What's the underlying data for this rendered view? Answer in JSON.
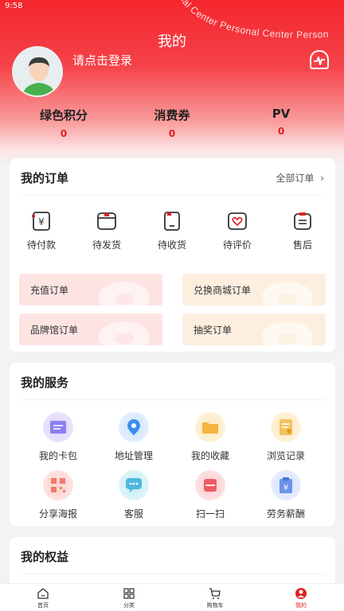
{
  "status_bar": {
    "time": "9:58"
  },
  "header": {
    "title": "我的",
    "login_prompt": "请点击登录",
    "arc_text": "onal Center Personal Center Person"
  },
  "stats": [
    {
      "label": "绿色积分",
      "value": "0"
    },
    {
      "label": "消费券",
      "value": "0"
    },
    {
      "label": "PV",
      "value": "0"
    }
  ],
  "orders": {
    "title": "我的订单",
    "all_link": "全部订单",
    "statuses": [
      {
        "label": "待付款",
        "icon": "pending-payment-icon"
      },
      {
        "label": "待发货",
        "icon": "pending-shipment-icon"
      },
      {
        "label": "待收货",
        "icon": "pending-receipt-icon"
      },
      {
        "label": "待评价",
        "icon": "pending-review-icon"
      },
      {
        "label": "售后",
        "icon": "after-sales-icon"
      }
    ],
    "entries": [
      {
        "label": "充值订单"
      },
      {
        "label": "兑换商城订单"
      },
      {
        "label": "品牌馆订单"
      },
      {
        "label": "抽奖订单"
      }
    ]
  },
  "services": {
    "title": "我的服务",
    "items": [
      {
        "label": "我的卡包",
        "icon": "card-wallet-icon"
      },
      {
        "label": "地址管理",
        "icon": "location-pin-icon"
      },
      {
        "label": "我的收藏",
        "icon": "folder-icon"
      },
      {
        "label": "浏览记录",
        "icon": "document-history-icon"
      },
      {
        "label": "分享海报",
        "icon": "qr-code-icon"
      },
      {
        "label": "客服",
        "icon": "chat-icon"
      },
      {
        "label": "扫一扫",
        "icon": "scan-icon"
      },
      {
        "label": "劳务薪酬",
        "icon": "salary-icon"
      }
    ]
  },
  "benefits": {
    "title": "我的权益"
  },
  "tabbar": [
    {
      "label": "首页",
      "icon": "home-icon"
    },
    {
      "label": "分类",
      "icon": "grid-icon"
    },
    {
      "label": "购物车",
      "icon": "cart-icon"
    },
    {
      "label": "我的",
      "icon": "profile-icon",
      "active": true
    }
  ],
  "colors": {
    "accent": "#e02020",
    "header_red": "#f4262c"
  }
}
